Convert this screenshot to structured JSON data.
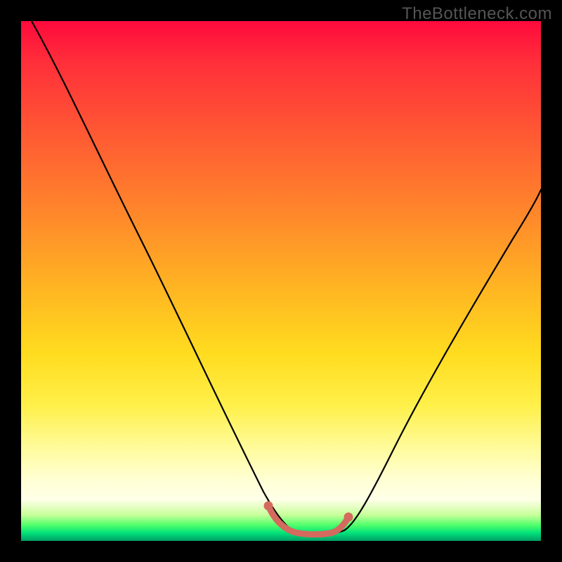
{
  "watermark": "TheBottleneck.com",
  "chart_data": {
    "type": "line",
    "title": "",
    "xlabel": "",
    "ylabel": "",
    "xlim": [
      0,
      1
    ],
    "ylim": [
      0,
      1
    ],
    "series": [
      {
        "name": "curve",
        "x": [
          0.02,
          0.06,
          0.12,
          0.18,
          0.25,
          0.32,
          0.38,
          0.44,
          0.49,
          0.52,
          0.56,
          0.6,
          0.63,
          0.67,
          0.72,
          0.78,
          0.84,
          0.9,
          0.96,
          1.0
        ],
        "y": [
          1.0,
          0.9,
          0.77,
          0.65,
          0.52,
          0.39,
          0.28,
          0.16,
          0.06,
          0.015,
          0.012,
          0.012,
          0.018,
          0.05,
          0.12,
          0.22,
          0.33,
          0.44,
          0.55,
          0.62
        ],
        "color": "#000000"
      },
      {
        "name": "bottom-marker",
        "x": [
          0.49,
          0.505,
          0.52,
          0.54,
          0.56,
          0.58,
          0.6,
          0.615,
          0.63
        ],
        "y": [
          0.06,
          0.035,
          0.018,
          0.012,
          0.012,
          0.012,
          0.013,
          0.018,
          0.035
        ],
        "color": "#d46a5e"
      }
    ],
    "annotations": [],
    "colors": {
      "top": "#ff0a3c",
      "mid": "#ffdc1f",
      "bottom": "#009e66",
      "frame": "#000000"
    }
  }
}
